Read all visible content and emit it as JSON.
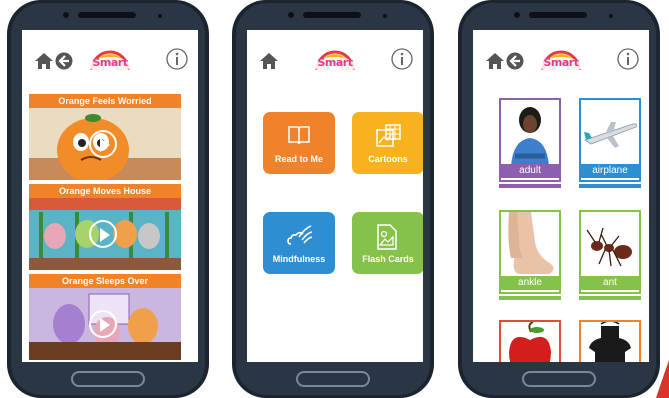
{
  "colors": {
    "orange": "#f0822a",
    "yellow": "#f7b21e",
    "blue": "#2f8ed2",
    "green": "#86c14a",
    "purple": "#8e5fb0",
    "red": "#e24a3a",
    "phone_body": "#1c2430"
  },
  "app": {
    "logo_text": "Smart",
    "icons": [
      "home-icon",
      "back-icon",
      "info-icon"
    ]
  },
  "cartoons_screen": {
    "videos": [
      {
        "title": "Orange Feels Worried"
      },
      {
        "title": "Orange Moves House"
      },
      {
        "title": "Orange Sleeps Over"
      }
    ]
  },
  "menu_screen": {
    "tiles": [
      {
        "label": "Read to Me",
        "icon": "book-icon"
      },
      {
        "label": "Cartoons",
        "icon": "film-icon"
      },
      {
        "label": "Mindfulness",
        "icon": "wind-cloud-icon"
      },
      {
        "label": "Flash Cards",
        "icon": "card-image-icon"
      }
    ]
  },
  "flashcards_screen": {
    "cards": [
      {
        "word": "adult"
      },
      {
        "word": "airplane"
      },
      {
        "word": "ankle"
      },
      {
        "word": "ant"
      },
      {
        "word": ""
      },
      {
        "word": ""
      }
    ]
  }
}
